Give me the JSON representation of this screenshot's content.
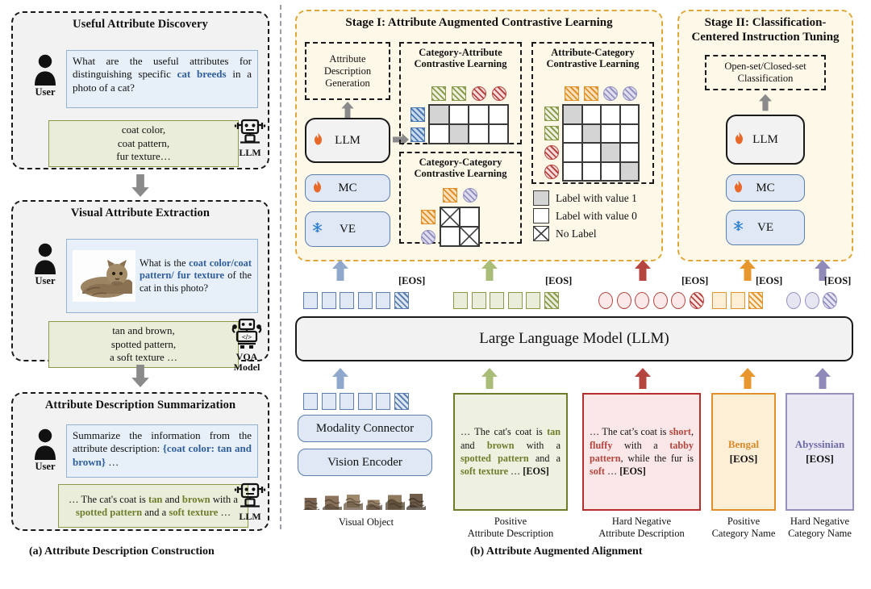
{
  "figure": {
    "caption_a": "(a) Attribute Description Construction",
    "caption_b": "(b) Attribute Augmented Alignment"
  },
  "panel_a": {
    "cards": [
      {
        "title": "Useful Attribute Discovery",
        "user_label": "User",
        "agent_label": "LLM",
        "agent_icon": "robot-icon",
        "user_icon": "person-icon",
        "prompt_parts": [
          {
            "t": "What are the useful attributes for distinguishing specific ",
            "hl": false
          },
          {
            "t": "cat breeds",
            "hl": true
          },
          {
            "t": " in a photo of a cat?",
            "hl": false
          }
        ],
        "answer_lines": [
          "coat color,",
          "coat pattern,",
          "fur texture…"
        ]
      },
      {
        "title": "Visual Attribute Extraction",
        "user_label": "User",
        "agent_label": "VQA Model",
        "agent_icon": "vqa-robot-icon",
        "user_icon": "person-icon",
        "prompt_parts": [
          {
            "t": "What is the ",
            "hl": false
          },
          {
            "t": "coat color/coat pattern/ fur texture",
            "hl": true
          },
          {
            "t": " of the cat in this photo?",
            "hl": false
          }
        ],
        "answer_lines": [
          "tan and brown,",
          "spotted pattern,",
          "a soft texture …"
        ]
      },
      {
        "title": "Attribute Description Summarization",
        "user_label": "User",
        "agent_label": "LLM",
        "agent_icon": "robot-icon",
        "user_icon": "person-icon",
        "prompt_parts": [
          {
            "t": "Summarize the information from the attribute description: ",
            "hl": false
          },
          {
            "t": "{coat color: tan and brown}",
            "hl": true
          },
          {
            "t": " …",
            "hl": false
          }
        ],
        "answer_rich": [
          {
            "t": "… The cat's coat is ",
            "c": "none"
          },
          {
            "t": "tan",
            "c": "green"
          },
          {
            "t": " and ",
            "c": "none"
          },
          {
            "t": "brown",
            "c": "green"
          },
          {
            "t": " with a ",
            "c": "none"
          },
          {
            "t": "spotted pattern",
            "c": "green"
          },
          {
            "t": " and a ",
            "c": "none"
          },
          {
            "t": "soft texture",
            "c": "green"
          },
          {
            "t": " …",
            "c": "none"
          }
        ]
      }
    ]
  },
  "stage1": {
    "title": "Stage I: Attribute Augmented Contrastive Learning",
    "adg_box": {
      "lines": [
        "Attribute",
        "Description",
        "Generation"
      ]
    },
    "modules": [
      {
        "name": "LLM",
        "icon": "fire-icon"
      },
      {
        "name": "MC",
        "icon": "fire-icon"
      },
      {
        "name": "VE",
        "icon": "snowflake-icon"
      }
    ],
    "blocks": [
      {
        "id": "cat-attr",
        "title": [
          "Category-Attribute",
          "Contrastive Learning"
        ]
      },
      {
        "id": "attr-cat",
        "title": [
          "Attribute-Category",
          "Contrastive Learning"
        ]
      },
      {
        "id": "cat-cat",
        "title": [
          "Category-Category",
          "Contrastive Learning"
        ]
      }
    ],
    "legend": [
      {
        "label": "Label with value 1",
        "swatch": "gray"
      },
      {
        "label": "Label with value 0",
        "swatch": "white"
      },
      {
        "label": "No Label",
        "swatch": "crossed"
      }
    ]
  },
  "stage2": {
    "title": [
      "Stage II: Classification-",
      "Centered Instruction Tuning"
    ],
    "task_box": [
      "Open-set/Closed-set",
      "Classification"
    ],
    "modules": [
      {
        "name": "LLM",
        "icon": "fire-icon"
      },
      {
        "name": "MC",
        "icon": "fire-icon"
      },
      {
        "name": "VE",
        "icon": "snowflake-icon"
      }
    ]
  },
  "backbone": {
    "llm_label": "Large Language Model (LLM)",
    "modality_connector": "Modality Connector",
    "vision_encoder": "Vision Encoder",
    "eos_label": "[EOS]"
  },
  "token_groups": [
    {
      "name": "visual-tokens",
      "shape": "square",
      "plain": 5,
      "hatched": 1,
      "border": "#5b7fae",
      "fill": "#dfe8f4"
    },
    {
      "name": "positive-attribute-tokens",
      "shape": "square",
      "plain": 5,
      "hatched": 1,
      "border": "#8a9a4b",
      "fill": "#e9edd9"
    },
    {
      "name": "hard-negative-attribute-tokens",
      "shape": "circle",
      "plain": 5,
      "hatched": 1,
      "border": "#b5453f",
      "fill": "#fbe8e8"
    },
    {
      "name": "positive-category-tokens",
      "shape": "square",
      "plain": 2,
      "hatched": 1,
      "border": "#e0952f",
      "fill": "#fdeed6"
    },
    {
      "name": "hard-negative-category-tokens",
      "shape": "circle",
      "plain": 2,
      "hatched": 1,
      "border": "#9490c0",
      "fill": "#e6e5f2"
    }
  ],
  "inputs": [
    {
      "name": "visual-object",
      "caption": [
        "Visual Object"
      ],
      "kind": "image-strip"
    },
    {
      "name": "positive-attribute-description",
      "caption": [
        "Positive",
        "Attribute Description"
      ],
      "border": "#6d7d2c",
      "fill": "#eef1e0",
      "rich": [
        {
          "t": "…  The cat's coat is ",
          "c": "none"
        },
        {
          "t": "tan",
          "c": "green"
        },
        {
          "t": " and ",
          "c": "none"
        },
        {
          "t": "brown",
          "c": "green"
        },
        {
          "t": " with a ",
          "c": "none"
        },
        {
          "t": "spotted pattern",
          "c": "green"
        },
        {
          "t": " and a ",
          "c": "none"
        },
        {
          "t": "soft texture",
          "c": "green"
        },
        {
          "t": " … ",
          "c": "none"
        },
        {
          "t": "[EOS]",
          "c": "bold"
        }
      ]
    },
    {
      "name": "hard-negative-attribute-description",
      "caption": [
        "Hard Negative",
        "Attribute Description"
      ],
      "border": "#b5302c",
      "fill": "#fbe7e7",
      "rich": [
        {
          "t": "…  The cat’s coat is ",
          "c": "none"
        },
        {
          "t": "short",
          "c": "red"
        },
        {
          "t": ", ",
          "c": "none"
        },
        {
          "t": "fluffy",
          "c": "red"
        },
        {
          "t": " with a ",
          "c": "none"
        },
        {
          "t": "tabby pattern",
          "c": "red"
        },
        {
          "t": ", while the fur is ",
          "c": "none"
        },
        {
          "t": "soft",
          "c": "red"
        },
        {
          "t": " … ",
          "c": "none"
        },
        {
          "t": "[EOS]",
          "c": "bold"
        }
      ]
    },
    {
      "name": "positive-category-name",
      "caption": [
        "Positive",
        "Category Name"
      ],
      "border": "#e0902a",
      "fill": "#fdeed6",
      "rich": [
        {
          "t": "Bengal",
          "c": "orange"
        },
        {
          "t": "\n",
          "c": "none"
        },
        {
          "t": "[EOS]",
          "c": "bold"
        }
      ]
    },
    {
      "name": "hard-negative-category-name",
      "caption": [
        "Hard Negative",
        "Category Name"
      ],
      "border": "#9490c0",
      "fill": "#e9e8f3",
      "rich": [
        {
          "t": "Abyssinian",
          "c": "purple"
        },
        {
          "t": "\n",
          "c": "none"
        },
        {
          "t": "[EOS]",
          "c": "bold"
        }
      ]
    }
  ],
  "arrows": [
    {
      "name": "visual-arrow",
      "color": "#8fa8cc"
    },
    {
      "name": "positive-attribute-arrow",
      "color": "#a9bc78"
    },
    {
      "name": "hard-negative-attribute-arrow",
      "color": "#b5453f"
    },
    {
      "name": "positive-category-arrow",
      "color": "#e8962e"
    },
    {
      "name": "hard-negative-category-arrow",
      "color": "#8f8ab8"
    }
  ],
  "matrices": {
    "category_attribute": {
      "rows": 2,
      "cols": 4,
      "row_tokens": [
        {
          "shape": "square",
          "border": "#4a77b0",
          "fill": "#c9daee",
          "hatched": true
        },
        {
          "shape": "square",
          "border": "#4a77b0",
          "fill": "#c9daee",
          "hatched": true
        }
      ],
      "col_tokens": [
        {
          "shape": "square",
          "border": "#8a9a4b",
          "fill": "#eef1e0",
          "hatched": true
        },
        {
          "shape": "square",
          "border": "#8a9a4b",
          "fill": "#eef1e0",
          "hatched": true
        },
        {
          "shape": "circle",
          "border": "#b5453f",
          "fill": "#f7dddd",
          "hatched": true
        },
        {
          "shape": "circle",
          "border": "#b5453f",
          "fill": "#f7dddd",
          "hatched": true
        }
      ],
      "values": [
        [
          1,
          0,
          0,
          0
        ],
        [
          0,
          1,
          0,
          0
        ]
      ]
    },
    "attribute_category": {
      "rows": 4,
      "cols": 4,
      "row_tokens": [
        {
          "shape": "square",
          "border": "#8a9a4b",
          "fill": "#eef1e0",
          "hatched": true
        },
        {
          "shape": "square",
          "border": "#8a9a4b",
          "fill": "#eef1e0",
          "hatched": true
        },
        {
          "shape": "circle",
          "border": "#b5453f",
          "fill": "#f7dddd",
          "hatched": true
        },
        {
          "shape": "circle",
          "border": "#b5453f",
          "fill": "#f7dddd",
          "hatched": true
        }
      ],
      "col_tokens": [
        {
          "shape": "square",
          "border": "#e0902a",
          "fill": "#fbe2bd",
          "hatched": true
        },
        {
          "shape": "square",
          "border": "#e0902a",
          "fill": "#fbe2bd",
          "hatched": true
        },
        {
          "shape": "circle",
          "border": "#9490c0",
          "fill": "#e0dff0",
          "hatched": true
        },
        {
          "shape": "circle",
          "border": "#9490c0",
          "fill": "#e0dff0",
          "hatched": true
        }
      ],
      "values": [
        [
          1,
          0,
          0,
          0
        ],
        [
          0,
          1,
          0,
          0
        ],
        [
          0,
          0,
          1,
          0
        ],
        [
          0,
          0,
          0,
          1
        ]
      ]
    },
    "category_category": {
      "rows": 2,
      "cols": 2,
      "row_tokens": [
        {
          "shape": "square",
          "border": "#e0902a",
          "fill": "#fbe2bd",
          "hatched": true
        },
        {
          "shape": "circle",
          "border": "#9490c0",
          "fill": "#e0dff0",
          "hatched": true
        }
      ],
      "col_tokens": [
        {
          "shape": "square",
          "border": "#e0902a",
          "fill": "#fbe2bd",
          "hatched": true
        },
        {
          "shape": "circle",
          "border": "#9490c0",
          "fill": "#e0dff0",
          "hatched": true
        }
      ],
      "values": [
        [
          "x",
          0
        ],
        [
          0,
          "x"
        ]
      ]
    }
  },
  "colors": {
    "stage_border": "#e0a83c",
    "stage_bg": "#fdf8e8",
    "gray_fill": "#d4d4d4",
    "blue": "#5b7fae",
    "green": "#8a9a4b",
    "red": "#b5453f",
    "orange": "#e0902a",
    "purple": "#9490c0"
  }
}
